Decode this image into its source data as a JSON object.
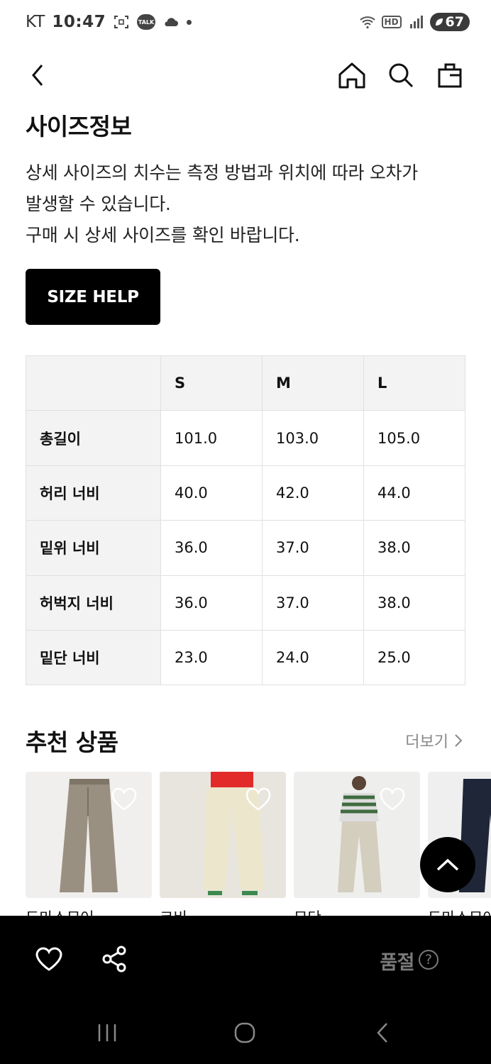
{
  "status_bar": {
    "carrier": "KT",
    "time": "10:47",
    "talk_badge": "TALK",
    "hd_badge": "HD",
    "battery": "67"
  },
  "icons": {
    "back": "chevron-left-icon",
    "home": "home-icon",
    "search": "search-icon",
    "bag": "shopping-bag-icon"
  },
  "size_info": {
    "title": "사이즈정보",
    "notice_lines": [
      "상세 사이즈의 치수는 측정 방법과 위치에 따라 오차가",
      "발생할 수 있습니다.",
      "구매 시 상세 사이즈를 확인 바랍니다."
    ],
    "help_button": "SIZE HELP",
    "table": {
      "headers": [
        "",
        "S",
        "M",
        "L"
      ],
      "rows": [
        {
          "label": "총길이",
          "values": [
            "101.0",
            "103.0",
            "105.0"
          ]
        },
        {
          "label": "허리 너비",
          "values": [
            "40.0",
            "42.0",
            "44.0"
          ]
        },
        {
          "label": "밑위 너비",
          "values": [
            "36.0",
            "37.0",
            "38.0"
          ]
        },
        {
          "label": "허벅지 너비",
          "values": [
            "36.0",
            "37.0",
            "38.0"
          ]
        },
        {
          "label": "밑단 너비",
          "values": [
            "23.0",
            "24.0",
            "25.0"
          ]
        }
      ]
    }
  },
  "recommended": {
    "title": "추천 상품",
    "more_label": "더보기",
    "products": [
      {
        "name": "도마스모어"
      },
      {
        "name": "코비"
      },
      {
        "name": "모단"
      },
      {
        "name": "도마스모어"
      }
    ]
  },
  "bottom_bar": {
    "status_label": "품절",
    "help_glyph": "?"
  },
  "colors": {
    "primary": "#000000",
    "table_header_bg": "#f3f3f3",
    "muted_text": "#888888"
  }
}
